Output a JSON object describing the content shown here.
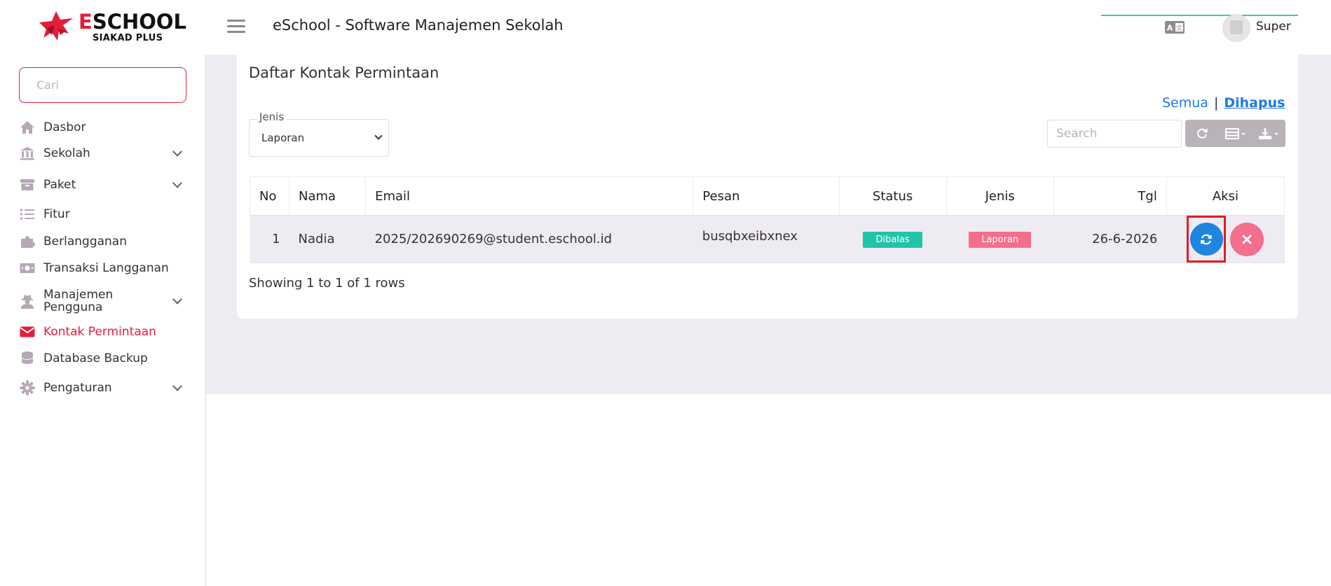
{
  "header": {
    "logo_text_first": "E",
    "logo_text_rest": "SCHOOL",
    "logo_sub": "SIAKAD PLUS",
    "app_title": "eSchool - Software Manajemen Sekolah",
    "user_name": "Super"
  },
  "sidebar": {
    "search_placeholder": "Cari",
    "items": [
      {
        "label": "Dasbor",
        "icon": "home-icon"
      },
      {
        "label": "Sekolah",
        "icon": "school-icon",
        "has_submenu": true
      },
      {
        "label": "Paket",
        "icon": "package-icon",
        "has_submenu": true
      },
      {
        "label": "Fitur",
        "icon": "list-icon"
      },
      {
        "label": "Berlangganan",
        "icon": "puzzle-icon"
      },
      {
        "label": "Transaksi Langganan",
        "icon": "money-icon"
      },
      {
        "label": "Manajemen",
        "label2": "Pengguna",
        "icon": "user-secret-icon",
        "has_submenu": true
      },
      {
        "label": "Kontak Permintaan",
        "icon": "envelope-icon",
        "active": true
      },
      {
        "label": "Database Backup",
        "icon": "database-icon"
      },
      {
        "label": "Pengaturan",
        "icon": "gear-icon",
        "has_submenu": true
      }
    ]
  },
  "main": {
    "card_title": "Daftar Kontak Permintaan",
    "filter": {
      "all": "Semua",
      "separator": "|",
      "deleted": "Dihapus"
    },
    "jenis_field": {
      "legend": "Jenis",
      "value": "Laporan"
    },
    "table_search_placeholder": "Search",
    "table": {
      "headers": [
        "No",
        "Nama",
        "Email",
        "Pesan",
        "Status",
        "Jenis",
        "Tgl",
        "Aksi"
      ],
      "rows": [
        {
          "no": "1",
          "nama": "Nadia",
          "email": "2025/202690269@student.eschool.id",
          "pesan": "busqbxeibxnex",
          "status": "Dibalas",
          "jenis": "Laporan",
          "tgl": "26-6-2026"
        }
      ]
    },
    "pagination_info": "Showing 1 to 1 of 1 rows"
  },
  "colors": {
    "brand_red": "#e31e3a",
    "link_blue": "#1f7ae0",
    "status_green": "#22c4a8",
    "jenis_pink": "#f46f8d",
    "main_bg": "#efebf2"
  }
}
